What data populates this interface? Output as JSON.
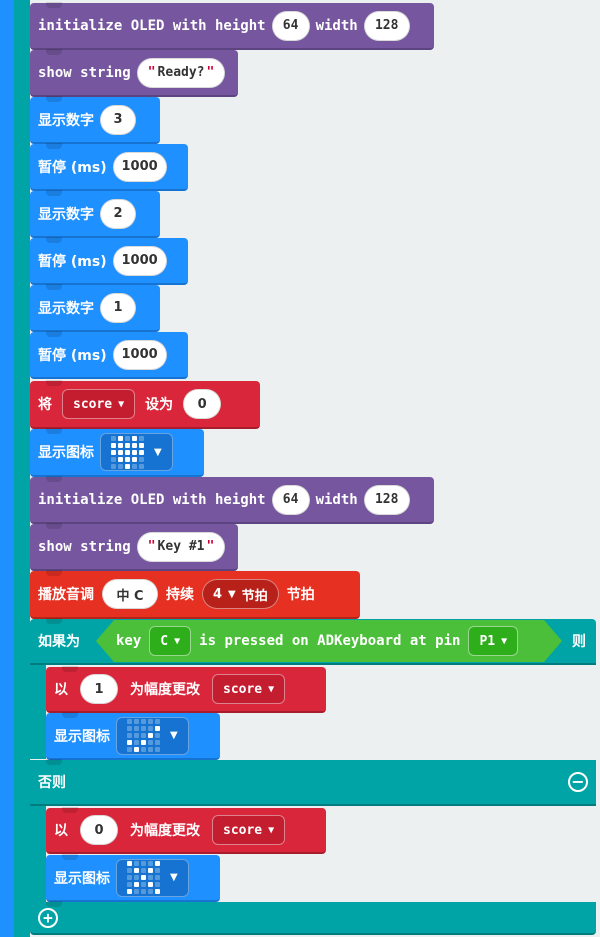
{
  "blocks": {
    "init1": {
      "label": "initialize OLED with height",
      "height": "64",
      "width_label": "width",
      "width": "128"
    },
    "show1": {
      "label": "show string",
      "value": "Ready?"
    },
    "num3": {
      "label": "显示数字",
      "value": "3"
    },
    "pause1": {
      "label": "暂停 (ms)",
      "value": "1000"
    },
    "num2": {
      "label": "显示数字",
      "value": "2"
    },
    "pause2": {
      "label": "暂停 (ms)",
      "value": "1000"
    },
    "num1": {
      "label": "显示数字",
      "value": "1"
    },
    "pause3": {
      "label": "暂停 (ms)",
      "value": "1000"
    },
    "setvar": {
      "prefix": "将",
      "var": "score",
      "mid": "设为",
      "value": "0"
    },
    "showicon1": {
      "label": "显示图标",
      "icon": "heart-icon"
    },
    "init2": {
      "label": "initialize OLED with height",
      "height": "64",
      "width_label": "width",
      "width": "128"
    },
    "show2": {
      "label": "show string",
      "value": "Key #1"
    },
    "play": {
      "label": "播放音调",
      "note": "中 C",
      "mid": "持续",
      "beats": "4",
      "beats_unit": "节拍",
      "suffix": "节拍"
    },
    "ifblock": {
      "label": "如果为",
      "cond_key": "key",
      "key": "C",
      "cond_mid": "is pressed on ADKeyboard at pin",
      "pin": "P1",
      "then": "则"
    },
    "change1": {
      "prefix": "以",
      "value": "1",
      "mid": "为幅度更改",
      "var": "score"
    },
    "showicon2": {
      "label": "显示图标",
      "icon": "check-icon"
    },
    "else": {
      "label": "否则"
    },
    "change2": {
      "prefix": "以",
      "value": "0",
      "mid": "为幅度更改",
      "var": "score"
    },
    "showicon3": {
      "label": "显示图标",
      "icon": "x-icon"
    }
  },
  "colors": {
    "rail_blue": "#1e90ff",
    "rail_teal": "#00a4a6",
    "logic": "#00a4a6",
    "condition": "#4cbf3a"
  }
}
